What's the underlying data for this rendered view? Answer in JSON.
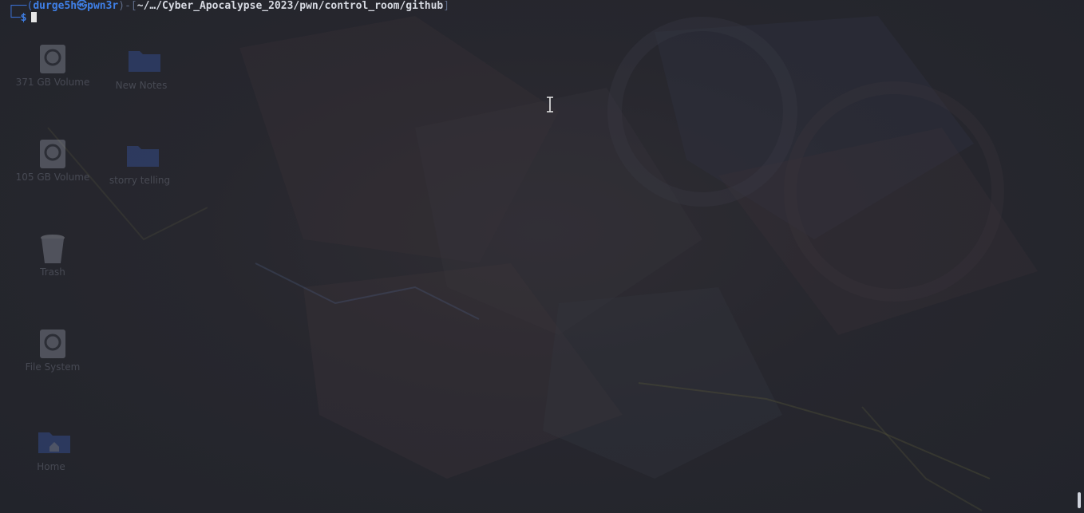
{
  "terminal": {
    "prompt": {
      "frame_top": "┌──(",
      "user": "durge5h",
      "at_symbol": "㉿",
      "host": "pwn3r",
      "frame_mid": ")-[",
      "path": "~/…/Cyber_Apocalypse_2023/pwn/control_room/github",
      "frame_end": "]",
      "frame_bottom": "└─",
      "dollar": "$"
    }
  },
  "desktop": {
    "icons": [
      {
        "label": "371 GB Volume",
        "icon": "drive-icon"
      },
      {
        "label": "New Notes",
        "icon": "folder-icon"
      },
      {
        "label": "105 GB Volume",
        "icon": "drive-icon"
      },
      {
        "label": "storry telling",
        "icon": "folder-icon"
      },
      {
        "label": "Trash",
        "icon": "trash-icon"
      },
      {
        "label": "File System",
        "icon": "drive-icon"
      },
      {
        "label": "Home",
        "icon": "home-folder-icon"
      }
    ]
  },
  "colors": {
    "background": "#24262e",
    "prompt_user": "#3f7fe6",
    "prompt_frame": "#3b6fd1",
    "path_text": "#d7dae2"
  }
}
